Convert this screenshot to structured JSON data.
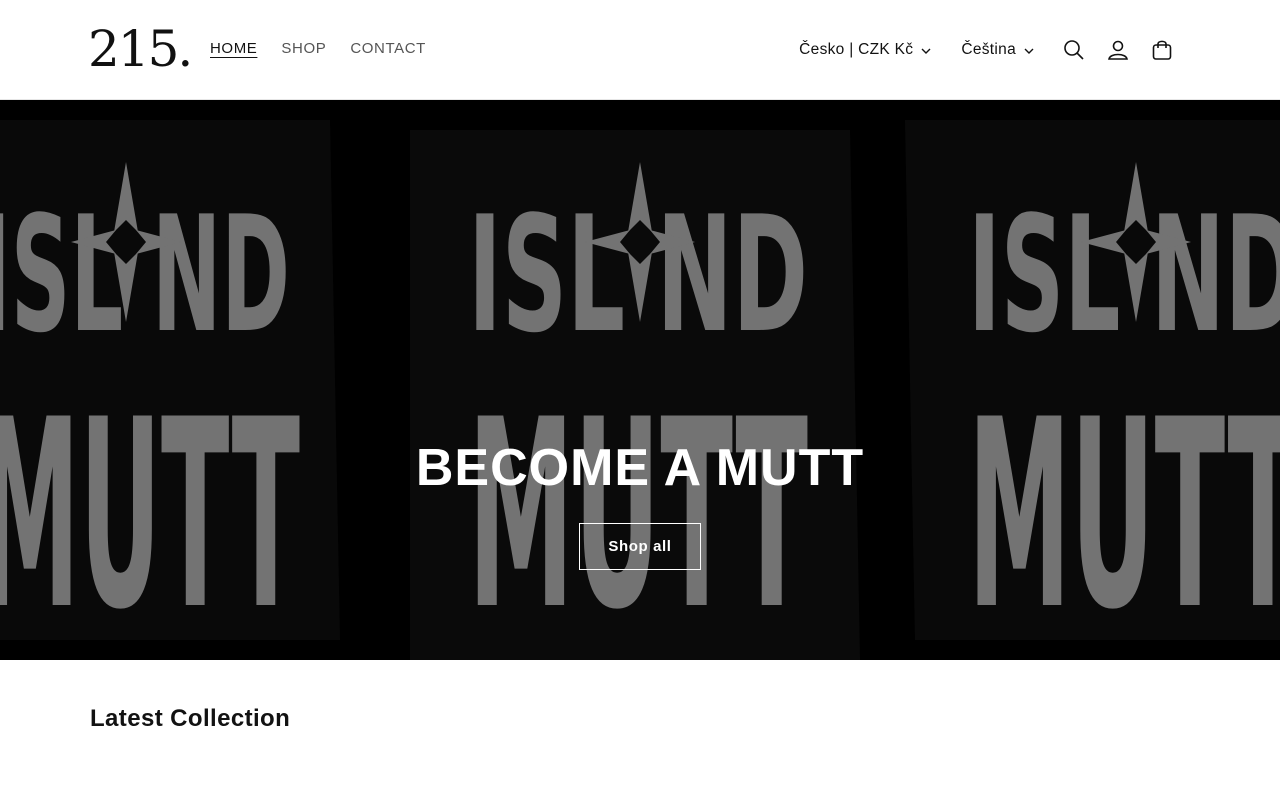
{
  "header": {
    "logo": "215.",
    "nav": [
      {
        "label": "HOME",
        "active": true
      },
      {
        "label": "SHOP",
        "active": false
      },
      {
        "label": "CONTACT",
        "active": false
      }
    ],
    "country_selector": "Česko | CZK Kč",
    "language_selector": "Čeština",
    "icons": [
      "search-icon",
      "account-icon",
      "cart-icon"
    ]
  },
  "hero": {
    "title": "BECOME A MUTT",
    "button": "Shop all",
    "shirt_text_line1": "ISL✱ND",
    "shirt_text_line2": "MUTT"
  },
  "latest": {
    "heading": "Latest Collection"
  }
}
